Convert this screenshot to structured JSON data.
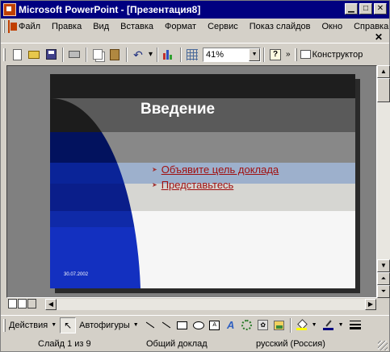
{
  "window": {
    "title": "Microsoft PowerPoint - [Презентация8]"
  },
  "menu": {
    "items": [
      "Файл",
      "Правка",
      "Вид",
      "Вставка",
      "Формат",
      "Сервис",
      "Показ слайдов",
      "Окно",
      "Справка"
    ]
  },
  "toolbar": {
    "zoom": "41%",
    "designer_label": "Конструктор"
  },
  "slide": {
    "title": "Введение",
    "bullets": [
      "Объявите цель доклада",
      "Представьтесь"
    ],
    "date": "30.07.2002",
    "colors": {
      "title_band": "#5a5a5a",
      "accent_band": "#9db0cc",
      "shape_dark": "#2a2a2a",
      "shape_blue": "#1330c0",
      "bullet_text": "#a01010"
    }
  },
  "drawing_toolbar": {
    "actions_label": "Действия",
    "autoshapes_label": "Автофигуры"
  },
  "status": {
    "slide_position": "Слайд 1 из 9",
    "design": "Общий доклад",
    "language": "русский (Россия)"
  }
}
